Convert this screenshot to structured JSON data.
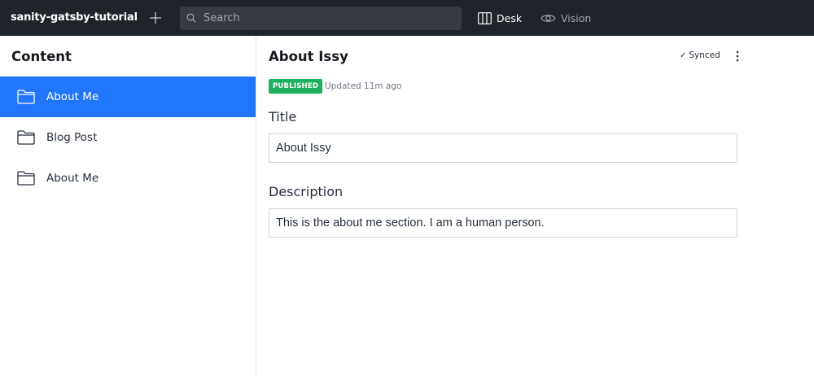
{
  "navbar": {
    "project_name": "sanity-gatsby-tutorial",
    "search_placeholder": "Search",
    "tools": [
      {
        "label": "Desk",
        "icon": "desk-columns-icon",
        "active": true
      },
      {
        "label": "Vision",
        "icon": "eye-icon",
        "active": false
      }
    ]
  },
  "sidebar": {
    "title": "Content",
    "items": [
      {
        "label": "About Me",
        "icon": "folder-icon",
        "active": true
      },
      {
        "label": "Blog Post",
        "icon": "folder-icon",
        "active": false
      },
      {
        "label": "About Me",
        "icon": "folder-icon",
        "active": false
      }
    ]
  },
  "document": {
    "title": "About Issy",
    "sync_status": "Synced",
    "status_badge": "PUBLISHED",
    "updated_text": "Updated 11m ago",
    "fields": [
      {
        "label": "Title",
        "value": "About Issy"
      },
      {
        "label": "Description",
        "value": "This is the about me section. I am a human person."
      }
    ]
  },
  "colors": {
    "navbar_bg": "#1f232a",
    "accent": "#2276fc",
    "published": "#1eaf60"
  }
}
